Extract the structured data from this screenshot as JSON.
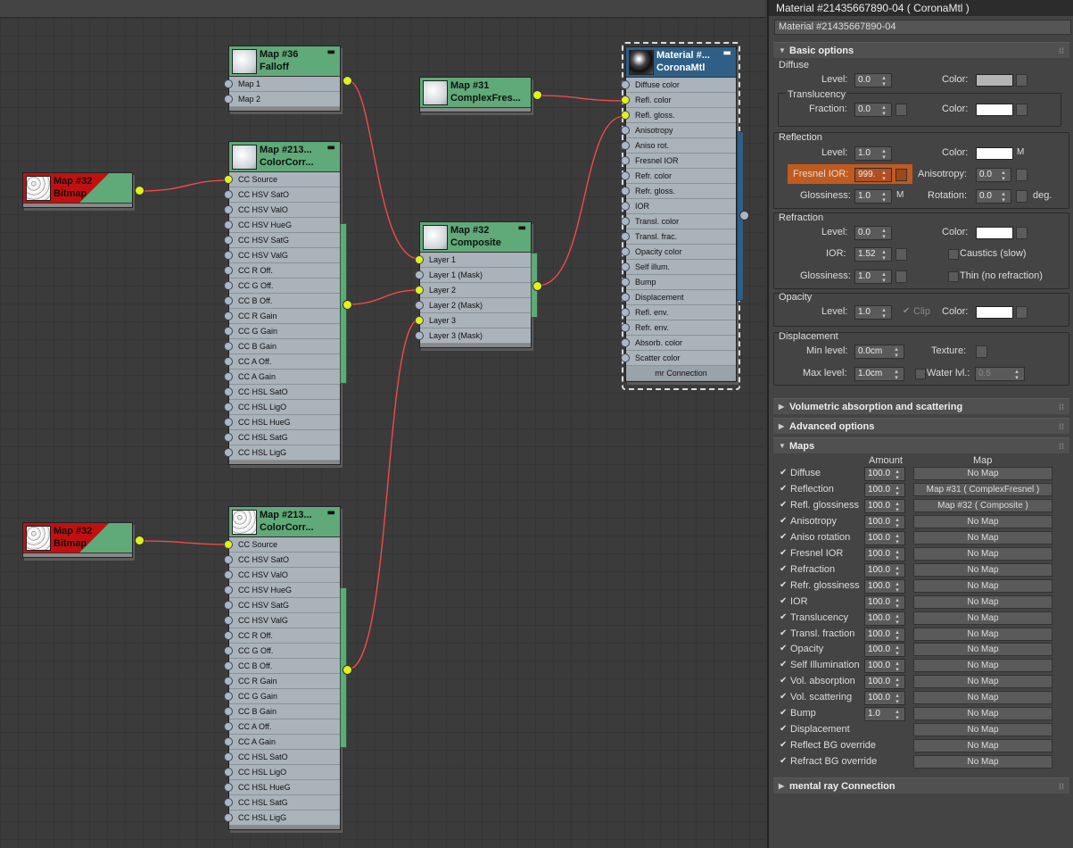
{
  "window": {
    "title": "Material #21435667890-04  ( CoronaMtl )",
    "name_field": "Material #21435667890-04"
  },
  "nodes": {
    "falloff": {
      "t1": "Map #36",
      "t2": "Falloff",
      "slots": [
        "Map 1",
        "Map 2"
      ]
    },
    "complexfresnel": {
      "t1": "Map #31",
      "t2": "ComplexFres..."
    },
    "cc1": {
      "t1": "Map #213...",
      "t2": "ColorCorr...",
      "slots": [
        "CC Source",
        "CC HSV SatO",
        "CC HSV ValO",
        "CC HSV HueG",
        "CC HSV SatG",
        "CC HSV ValG",
        "CC R Off.",
        "CC G Off.",
        "CC B Off.",
        "CC R Gain",
        "CC G Gain",
        "CC B Gain",
        "CC A Off.",
        "CC A Gain",
        "CC HSL SatO",
        "CC HSL LigO",
        "CC HSL HueG",
        "CC HSL SatG",
        "CC HSL LigG"
      ]
    },
    "cc2": {
      "t1": "Map #213...",
      "t2": "ColorCorr...",
      "slots": [
        "CC Source",
        "CC HSV SatO",
        "CC HSV ValO",
        "CC HSV HueG",
        "CC HSV SatG",
        "CC HSV ValG",
        "CC R Off.",
        "CC G Off.",
        "CC B Off.",
        "CC R Gain",
        "CC G Gain",
        "CC B Gain",
        "CC A Off.",
        "CC A Gain",
        "CC HSL SatO",
        "CC HSL LigO",
        "CC HSL HueG",
        "CC HSL SatG",
        "CC HSL LigG"
      ]
    },
    "bitmap1": {
      "t1": "Map #32",
      "t2": "Bitmap"
    },
    "bitmap2": {
      "t1": "Map #32",
      "t2": "Bitmap"
    },
    "composite": {
      "t1": "Map #32",
      "t2": "Composite",
      "slots": [
        "Layer 1",
        "Layer 1 (Mask)",
        "Layer 2",
        "Layer 2 (Mask)",
        "Layer 3",
        "Layer 3 (Mask)"
      ]
    },
    "material": {
      "t1": "Material #...",
      "t2": "CoronaMtl",
      "slots": [
        "Diffuse color",
        "Refl. color",
        "Refl. gloss.",
        "Anisotropy",
        "Aniso rot.",
        "Fresnel IOR",
        "Refr. color",
        "Refr. gloss.",
        "IOR",
        "Transl. color",
        "Transl. frac.",
        "Opacity color",
        "Self illum.",
        "Bump",
        "Displacement",
        "Refl. env.",
        "Refr. env.",
        "Absorb. color",
        "Scatter color"
      ],
      "footer": "mr Connection"
    }
  },
  "panel": {
    "basic": {
      "title": "Basic options",
      "diffuse": {
        "group": "Diffuse",
        "level_label": "Level:",
        "level": "0.0",
        "color_label": "Color:"
      },
      "translucency": {
        "group": "Translucency",
        "fraction_label": "Fraction:",
        "fraction": "0.0",
        "color_label": "Color:"
      },
      "reflection": {
        "group": "Reflection",
        "level_label": "Level:",
        "level": "1.0",
        "color_label": "Color:",
        "m": "M",
        "fresnel_label": "Fresnel IOR:",
        "fresnel": "999.",
        "aniso_label": "Anisotropy:",
        "aniso": "0.0",
        "gloss_label": "Glossiness:",
        "gloss": "1.0",
        "m2": "M",
        "rot_label": "Rotation:",
        "rot": "0.0",
        "deg": "deg."
      },
      "refraction": {
        "group": "Refraction",
        "level_label": "Level:",
        "level": "0.0",
        "color_label": "Color:",
        "ior_label": "IOR:",
        "ior": "1.52",
        "caustics": "Caustics (slow)",
        "gloss_label": "Glossiness:",
        "gloss": "1.0",
        "thin": "Thin (no refraction)"
      },
      "opacity": {
        "group": "Opacity",
        "level_label": "Level:",
        "level": "1.0",
        "clip": "Clip",
        "color_label": "Color:"
      },
      "displacement": {
        "group": "Displacement",
        "min_label": "Min level:",
        "min": "0.0cm",
        "texture_label": "Texture:",
        "max_label": "Max level:",
        "max": "1.0cm",
        "water_label": "Water lvl.:",
        "water": "0.5"
      }
    },
    "rollouts": {
      "volumetric": "Volumetric absorption and scattering",
      "advanced": "Advanced options",
      "maps": "Maps",
      "mentalray": "mental ray Connection"
    },
    "maps": {
      "col_amount": "Amount",
      "col_map": "Map",
      "rows": [
        {
          "name": "Diffuse",
          "amount": "100.0",
          "map": "No Map"
        },
        {
          "name": "Reflection",
          "amount": "100.0",
          "map": "Map #31  ( ComplexFresnel )"
        },
        {
          "name": "Refl. glossiness",
          "amount": "100.0",
          "map": "Map #32  ( Composite )"
        },
        {
          "name": "Anisotropy",
          "amount": "100.0",
          "map": "No Map"
        },
        {
          "name": "Aniso rotation",
          "amount": "100.0",
          "map": "No Map"
        },
        {
          "name": "Fresnel IOR",
          "amount": "100.0",
          "map": "No Map"
        },
        {
          "name": "Refraction",
          "amount": "100.0",
          "map": "No Map"
        },
        {
          "name": "Refr. glossiness",
          "amount": "100.0",
          "map": "No Map"
        },
        {
          "name": "IOR",
          "amount": "100.0",
          "map": "No Map"
        },
        {
          "name": "Translucency",
          "amount": "100.0",
          "map": "No Map"
        },
        {
          "name": "Transl. fraction",
          "amount": "100.0",
          "map": "No Map"
        },
        {
          "name": "Opacity",
          "amount": "100.0",
          "map": "No Map"
        },
        {
          "name": "Self Illumination",
          "amount": "100.0",
          "map": "No Map"
        },
        {
          "name": "Vol. absorption",
          "amount": "100.0",
          "map": "No Map"
        },
        {
          "name": "Vol. scattering",
          "amount": "100.0",
          "map": "No Map"
        },
        {
          "name": "Bump",
          "amount": "1.0",
          "map": "No Map"
        },
        {
          "name": "Displacement",
          "amount": "",
          "map": "No Map"
        },
        {
          "name": "Reflect BG override",
          "amount": "",
          "map": "No Map"
        },
        {
          "name": "Refract BG override",
          "amount": "",
          "map": "No Map"
        }
      ]
    }
  },
  "colors": {
    "wire": "#ff4a4a",
    "node_green": "#5faa78",
    "node_blue": "#2f5f86",
    "bitmap_red": "#c21010",
    "socket_on": "#dff21a",
    "highlight": "#c15a1e"
  }
}
